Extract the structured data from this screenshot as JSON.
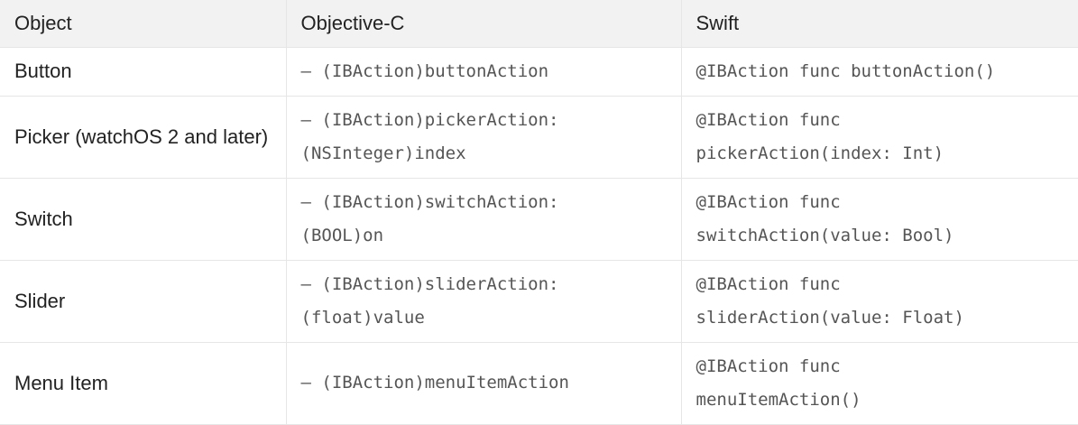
{
  "table": {
    "headers": {
      "object": "Object",
      "objc": "Objective-C",
      "swift": "Swift"
    },
    "rows": [
      {
        "object": "Button",
        "objc": [
          "– (IBAction)buttonAction"
        ],
        "swift": [
          "@IBAction func buttonAction()"
        ]
      },
      {
        "object": "Picker (watchOS 2 and later)",
        "objc": [
          "– (IBAction)pickerAction:",
          "(NSInteger)index"
        ],
        "swift": [
          "@IBAction func",
          "pickerAction(index: Int)"
        ]
      },
      {
        "object": "Switch",
        "objc": [
          "– (IBAction)switchAction:",
          "(BOOL)on"
        ],
        "swift": [
          "@IBAction func",
          "switchAction(value: Bool)"
        ]
      },
      {
        "object": "Slider",
        "objc": [
          "– (IBAction)sliderAction:",
          "(float)value"
        ],
        "swift": [
          "@IBAction func",
          "sliderAction(value: Float)"
        ]
      },
      {
        "object": "Menu Item",
        "objc": [
          "– (IBAction)menuItemAction"
        ],
        "swift": [
          "@IBAction func",
          "menuItemAction()"
        ]
      }
    ]
  }
}
